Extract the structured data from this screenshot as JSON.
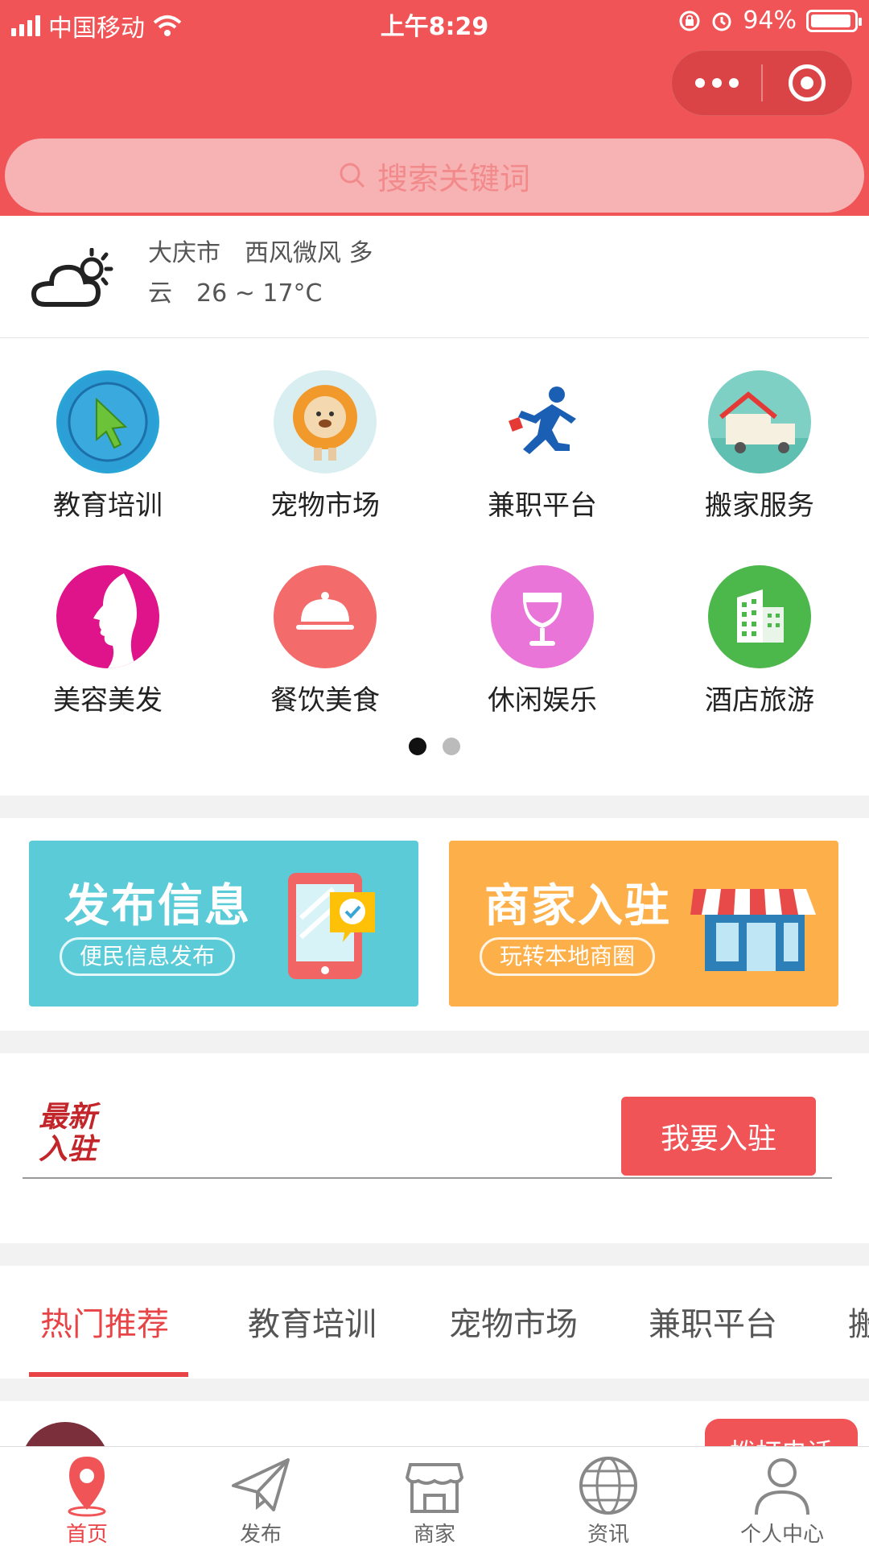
{
  "status_bar": {
    "carrier": "中国移动",
    "time": "上午8:29",
    "battery_percent": "94%",
    "battery_level": 0.94
  },
  "capsule": {
    "more_icon": "more-dots-icon",
    "close_icon": "target-circle-icon"
  },
  "search": {
    "placeholder": "搜索关键词",
    "icon": "search-icon"
  },
  "weather": {
    "icon": "cloud-sun-icon",
    "line1": "大庆市　西风微风 多",
    "line2": "云　26 ~ 17°C"
  },
  "categories": [
    {
      "label": "教育培训",
      "icon": "cursor-arrow-icon"
    },
    {
      "label": "宠物市场",
      "icon": "lion-icon"
    },
    {
      "label": "兼职平台",
      "icon": "running-man-icon"
    },
    {
      "label": "搬家服务",
      "icon": "moving-truck-icon"
    },
    {
      "label": "美容美发",
      "icon": "woman-face-icon"
    },
    {
      "label": "餐饮美食",
      "icon": "food-cloche-icon"
    },
    {
      "label": "休闲娱乐",
      "icon": "wine-glass-icon"
    },
    {
      "label": "酒店旅游",
      "icon": "building-icon"
    }
  ],
  "pager": {
    "pages": 2,
    "current": 1
  },
  "banners": [
    {
      "title": "发布信息",
      "subtitle": "便民信息发布",
      "color": "#5bcbd8",
      "icon": "phone-check-icon"
    },
    {
      "title": "商家入驻",
      "subtitle": "玩转本地商圈",
      "color": "#fdb04a",
      "icon": "storefront-icon"
    }
  ],
  "newest": {
    "logo_line1": "最新",
    "logo_line2": "入驻",
    "join_button": "我要入驻"
  },
  "tabs": [
    "热门推荐",
    "教育培训",
    "宠物市场",
    "兼职平台",
    "搬"
  ],
  "active_tab": 0,
  "peek": {
    "call_button": "拨打电话"
  },
  "bottom_nav": [
    {
      "label": "首页",
      "icon": "location-pin-icon"
    },
    {
      "label": "发布",
      "icon": "paper-plane-icon"
    },
    {
      "label": "商家",
      "icon": "shop-icon"
    },
    {
      "label": "资讯",
      "icon": "globe-icon"
    },
    {
      "label": "个人中心",
      "icon": "person-icon"
    }
  ],
  "colors": {
    "brand_red": "#f05456",
    "active_red": "#e84346"
  }
}
